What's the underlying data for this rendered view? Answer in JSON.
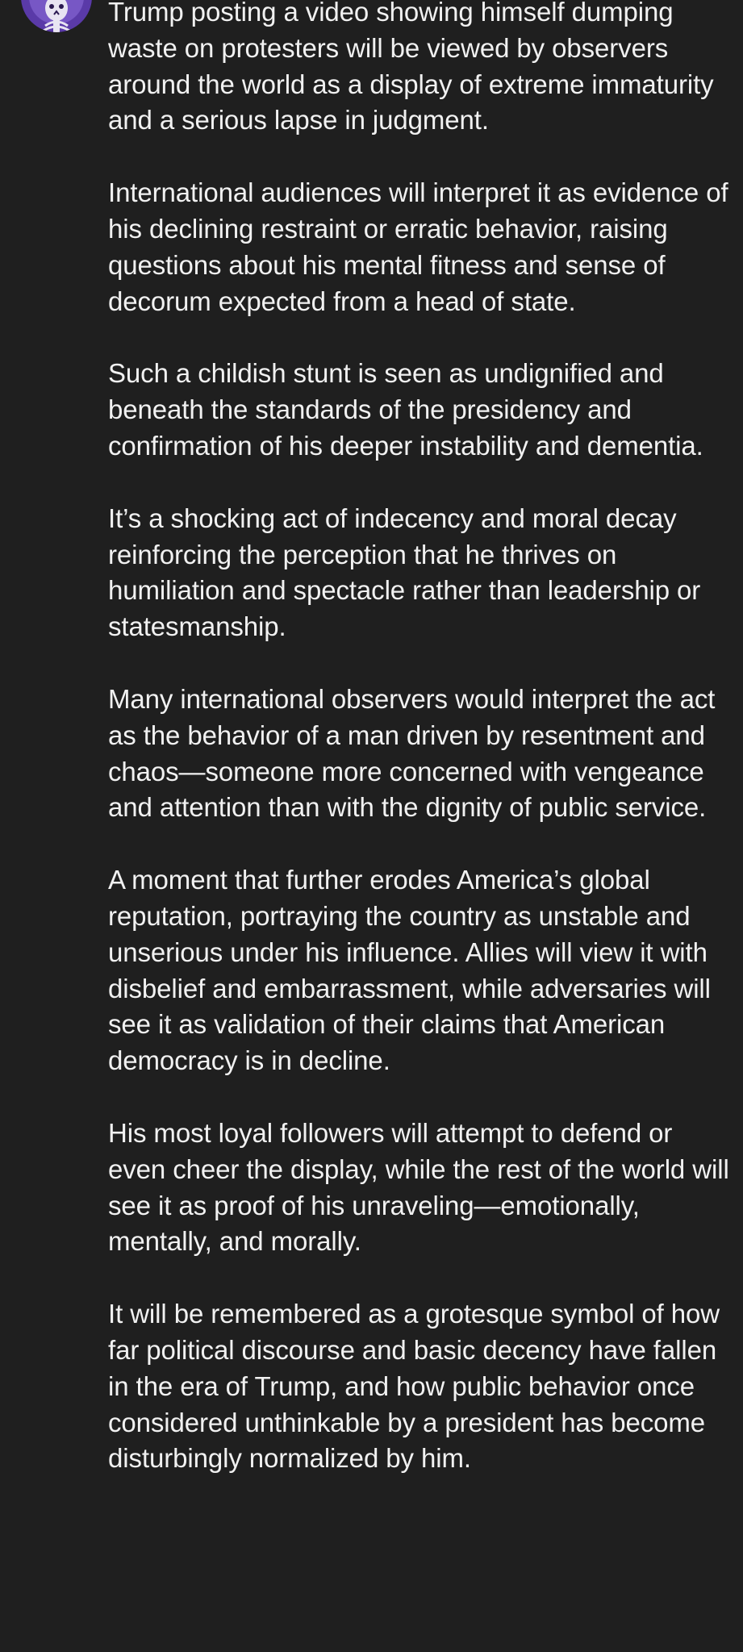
{
  "comment": {
    "paragraphs": [
      "Trump posting a video showing himself dumping waste on protesters will be viewed by observers around the world as a display of extreme immaturity and a serious lapse in judgment.",
      "International audiences will interpret it as evidence of his declining restraint or erratic behavior, raising questions about his mental fitness and sense of decorum expected from a head of state.",
      "Such a childish stunt is seen as undignified and beneath the standards of the presidency and confirmation of his deeper instability and dementia.",
      "It’s a shocking act of indecency and moral decay reinforcing the perception that he thrives on humiliation and spectacle rather than leadership or statesmanship.",
      "Many international observers would interpret the act as the behavior of a man driven by resentment and chaos—someone more concerned with vengeance and attention than with the dignity of public service.",
      "A moment that further erodes America’s global reputation, portraying the country as unstable and unserious under his influence. Allies will view it with disbelief and embarrassment, while adversaries will see it as validation of their claims that American democracy is in decline.",
      "His most loyal followers will attempt to defend or even cheer the display, while the rest of the world will see it as proof of his unraveling—emotionally, mentally, and morally.",
      "It will be remembered as a grotesque symbol of how far political discourse and basic decency have fallen in the era of Trump, and how public behavior once considered unthinkable by a president has become disturbingly normalized by him."
    ]
  },
  "theme": {
    "background": "#1f1f1f",
    "text": "#f1f1f1",
    "avatar_accent": "#7b5bd0"
  },
  "icons": {
    "avatar": "skeleton-avatar-icon"
  }
}
